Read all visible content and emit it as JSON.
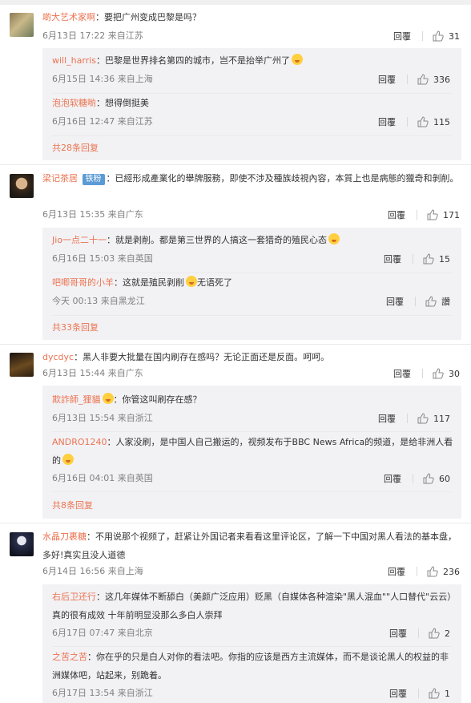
{
  "comments": [
    {
      "user": "啲大艺术家啊",
      "text": "：要把广州变成巴黎是吗？",
      "meta": "6月13日 17:22 来自江苏",
      "reply_label": "回覆",
      "likes": "31",
      "avatar_icon": "avatar-landscape-icon",
      "replies": [
        {
          "user": "will_harris",
          "text": "：巴黎是世界排名第四的城市，岂不是抬举广州了",
          "emoji": "tongue-emoji-icon",
          "meta": "6月15日 14:36 来自上海",
          "reply_label": "回覆",
          "likes": "336"
        },
        {
          "user": "泡泡软糖喲",
          "text": "：想得倒挺美",
          "meta": "6月16日 12:47 来自江苏",
          "reply_label": "回覆",
          "likes": "115"
        }
      ],
      "more_label": "共28条回复"
    },
    {
      "user": "梁记茶居",
      "badge": "铁粉",
      "text": "：已經形成產業化的舉牌服務，即使不涉及種族歧視內容，本質上也是病態的獵奇和剝削。",
      "meta": "6月13日 15:35 来自广东",
      "reply_label": "回覆",
      "likes": "171",
      "avatar_icon": "avatar-portrait-icon",
      "replies": [
        {
          "user": "Jio一点二十一",
          "text": "：就是剥削。都是第三世界的人搞这一套猎奇的殖民心态",
          "emoji": "sweat-emoji-icon",
          "meta": "6月16日 15:03 来自英国",
          "reply_label": "回覆",
          "likes": "15"
        },
        {
          "user": "吧唧哥哥的小羊",
          "text": "：这就是殖民剥削",
          "emoji": "smile-emoji-icon",
          "text_after": "无语死了",
          "meta": "今天 00:13 来自黑龙江",
          "reply_label": "回覆",
          "likes": "讚"
        }
      ],
      "more_label": "共33条回复"
    },
    {
      "user": "dycdyc",
      "text": "：黑人非要大批量在国内刷存在感吗？无论正面还是反面。呵呵。",
      "meta": "6月13日 15:44 来自广东",
      "reply_label": "回覆",
      "likes": "30",
      "avatar_icon": "avatar-dark-icon",
      "replies": [
        {
          "user": "欺詐師_狸貓",
          "emoji": "heart-eyes-emoji-icon",
          "text": "：你管这叫刷存在感？",
          "emoji_before_text": true,
          "meta": "6月13日 15:54 来自浙江",
          "reply_label": "回覆",
          "likes": "117"
        },
        {
          "user": "ANDRO1240",
          "text": "：人家没刷，是中国人自己搬运的，视频发布于BBC News Africa的频道，是给非洲人看的",
          "emoji": "heart-eyes-emoji-icon",
          "meta": "6月16日 04:01 来自英国",
          "reply_label": "回覆",
          "likes": "60"
        }
      ],
      "more_label": "共8条回复"
    },
    {
      "user": "水晶刀裹糖",
      "text": "：不用说那个视频了，赶紧让外国记者来看看这里评论区，了解一下中国对黑人看法的基本盘，多好!真实且没人道德",
      "meta": "6月14日 16:56 来自上海",
      "reply_label": "回覆",
      "likes": "236",
      "avatar_icon": "avatar-anime-icon",
      "replies": [
        {
          "user": "右后卫还行",
          "text": "：这几年媒体不断舔白（美颜广泛应用）贬黑（自媒体各种渲染\"黑人混血\"\"人口替代\"云云）真的很有成效 十年前明显没那么多白人崇拜",
          "meta": "6月17日 07:47 来自北京",
          "reply_label": "回覆",
          "likes": "2"
        },
        {
          "user": "之苦之苦",
          "text": "：你在乎的只是白人对你的看法吧。你指的应该是西方主流媒体，而不是谈论黑人的权益的非洲媒体吧，站起来，别跪着。",
          "meta": "6月17日 13:54 来自浙江",
          "reply_label": "回覆",
          "likes": "1"
        }
      ]
    }
  ],
  "colors": {
    "username": "#eb7350",
    "subbox_bg": "#f2f2f5",
    "meta": "#808080"
  }
}
